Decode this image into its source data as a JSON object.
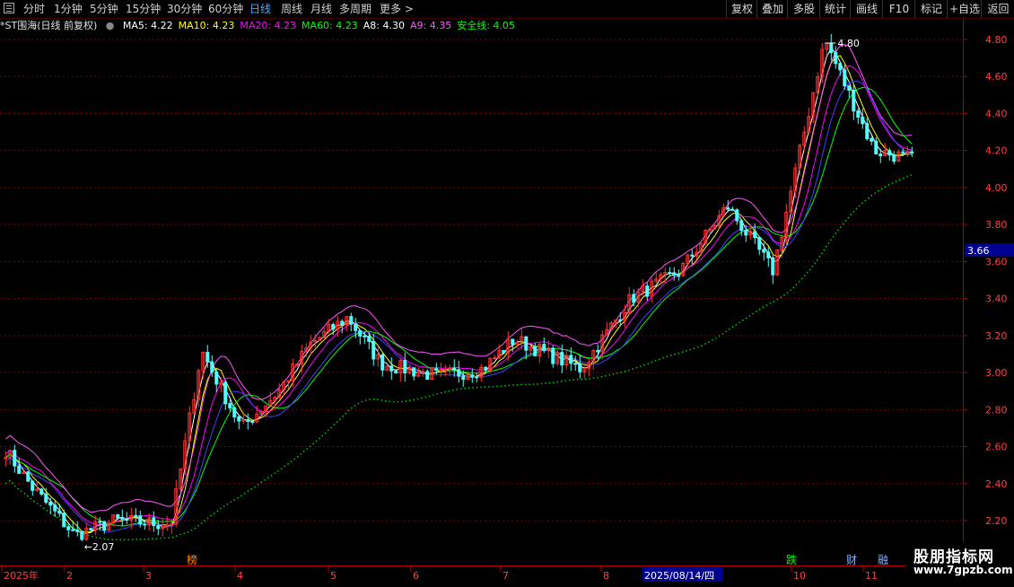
{
  "toolbar": {
    "periods": [
      "分时",
      "1分钟",
      "5分钟",
      "15分钟",
      "30分钟",
      "60分钟",
      "日线",
      "周线",
      "月线",
      "多周期",
      "更多"
    ],
    "active_period": "日线",
    "buttons": [
      "复权",
      "叠加",
      "多股",
      "统计",
      "画线",
      "F10",
      "标记",
      "+自选",
      "返回"
    ]
  },
  "legend": {
    "title": "*ST围海(日线 前复权)",
    "items": [
      {
        "label": "MA5: 4.22",
        "color": "#ffffff"
      },
      {
        "label": "MA10: 4.23",
        "color": "#ffff00"
      },
      {
        "label": "MA20: 4.23",
        "color": "#ff00ff"
      },
      {
        "label": "MA60: 4.23",
        "color": "#00ff00"
      },
      {
        "label": "A8: 4.30",
        "color": "#ffffff"
      },
      {
        "label": "A9: 4.35",
        "color": "#ff55ff"
      },
      {
        "label": "安全线: 4.05",
        "color": "#00ff00"
      }
    ]
  },
  "price_axis": {
    "ticks": [
      "4.80",
      "4.60",
      "4.40",
      "4.20",
      "4.00",
      "3.80",
      "3.60",
      "3.40",
      "3.20",
      "3.00",
      "2.80",
      "2.60",
      "2.40",
      "2.20"
    ],
    "cursor_value": "3.66",
    "min": 2.1,
    "max": 4.85
  },
  "annotations": {
    "high": "4.80",
    "low": "2.07",
    "date_tag": "2025/08/14/四",
    "event_markers": [
      {
        "text": "榜",
        "color": "#ff8800"
      },
      {
        "text": "跌",
        "color": "#00ff00"
      },
      {
        "text": "财",
        "color": "#8ab4ff"
      },
      {
        "text": "融",
        "color": "#8ab4ff"
      }
    ]
  },
  "time_axis": {
    "labels": [
      "2025年",
      "2",
      "3",
      "4",
      "5",
      "6",
      "7",
      "8",
      "10",
      "11"
    ]
  },
  "watermark": {
    "line1": "股朋指标网",
    "line2": "www.7gpzb.com"
  },
  "chart_data": {
    "type": "candlestick",
    "title": "*ST围海(日线 前复权)",
    "y_range": [
      2.1,
      4.85
    ],
    "close_anchors": [
      [
        "2025-01-02",
        2.58
      ],
      [
        "2025-01-15",
        2.38
      ],
      [
        "2025-02-05",
        2.12
      ],
      [
        "2025-02-20",
        2.2
      ],
      [
        "2025-03-10",
        2.18
      ],
      [
        "2025-03-20",
        3.12
      ],
      [
        "2025-04-03",
        2.7
      ],
      [
        "2025-04-15",
        2.9
      ],
      [
        "2025-04-25",
        3.15
      ],
      [
        "2025-05-08",
        3.3
      ],
      [
        "2025-05-20",
        3.05
      ],
      [
        "2025-06-10",
        2.98
      ],
      [
        "2025-06-25",
        3.02
      ],
      [
        "2025-07-05",
        3.18
      ],
      [
        "2025-07-25",
        3.02
      ],
      [
        "2025-08-10",
        3.4
      ],
      [
        "2025-08-25",
        3.55
      ],
      [
        "2025-09-10",
        3.9
      ],
      [
        "2025-09-25",
        3.55
      ],
      [
        "2025-10-15",
        4.8
      ],
      [
        "2025-11-05",
        4.2
      ],
      [
        "2025-11-20",
        4.15
      ]
    ],
    "safety_line_end": 4.05
  }
}
